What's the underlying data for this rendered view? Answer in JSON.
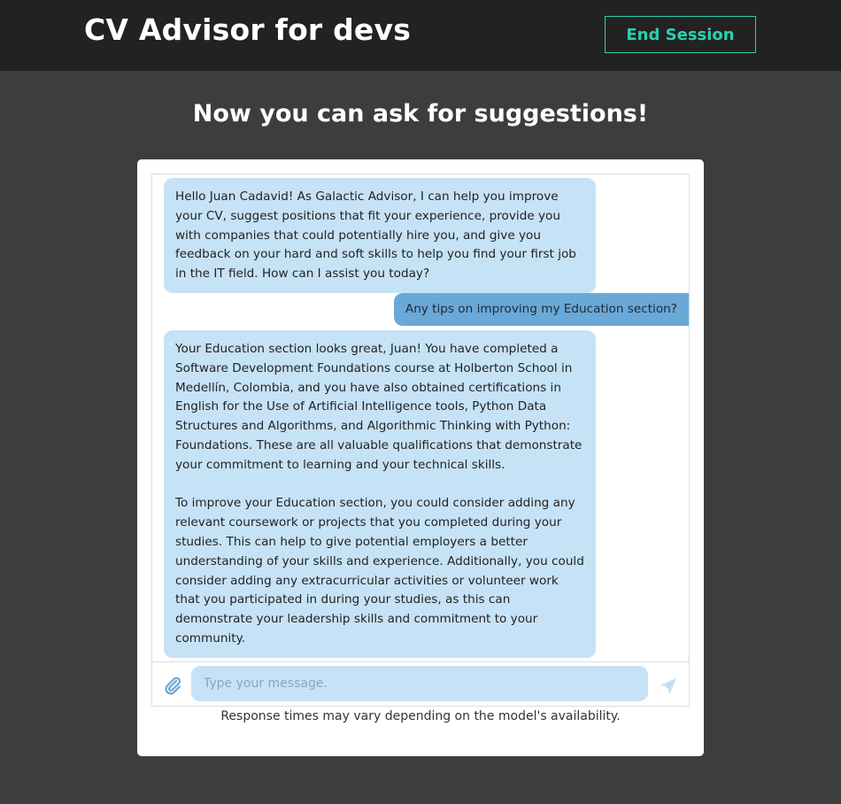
{
  "header": {
    "app_title": "CV Advisor for devs",
    "end_session_label": "End Session"
  },
  "main": {
    "heading": "Now you can ask for suggestions!"
  },
  "chat": {
    "messages": [
      {
        "role": "assistant",
        "paragraphs": [
          "Hello Juan Cadavid! As Galactic Advisor, I can help you improve your CV, suggest positions that fit your experience, provide you with companies that could potentially hire you, and give you feedback on your hard and soft skills to help you find your first job in the IT field. How can I assist you today?"
        ]
      },
      {
        "role": "user",
        "text": "Any tips on improving my Education section?"
      },
      {
        "role": "assistant",
        "paragraphs": [
          "Your Education section looks great, Juan! You have completed a Software Development Foundations course at Holberton School in Medellín, Colombia, and you have also obtained certifications in English for the Use of Artificial Intelligence tools, Python Data Structures and Algorithms, and Algorithmic Thinking with Python: Foundations. These are all valuable qualifications that demonstrate your commitment to learning and your technical skills.",
          "To improve your Education section, you could consider adding any relevant coursework or projects that you completed during your studies. This can help to give potential employers a better understanding of your skills and experience. Additionally, you could consider adding any extracurricular activities or volunteer work that you participated in during your studies, as this can demonstrate your leadership skills and commitment to your community."
        ]
      }
    ],
    "input_placeholder": "Type your message.",
    "input_value": "",
    "attach_icon": "paperclip-icon",
    "send_icon": "send-icon"
  },
  "footer_note": "Response times may vary depending on the model's availability.",
  "colors": {
    "accent": "#2bd0b0",
    "bot_bubble": "#c6e2f7",
    "user_bubble": "#6aa8d8",
    "background": "#3d3d3d",
    "topbar": "#222222"
  }
}
